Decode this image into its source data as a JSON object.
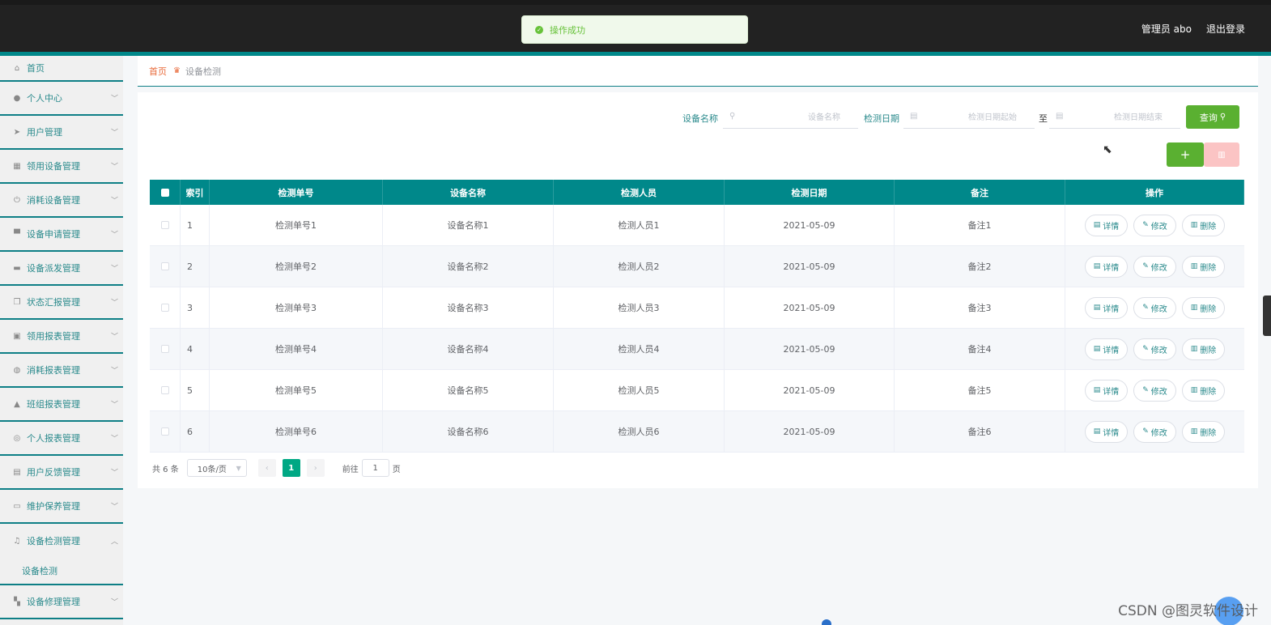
{
  "header": {
    "user": "管理员 abo",
    "logout": "退出登录"
  },
  "toast": {
    "message": "操作成功",
    "icon": "check-circle-icon"
  },
  "sidebar": {
    "items": [
      {
        "label": "首页",
        "icon": "home-icon"
      },
      {
        "label": "个人中心",
        "icon": "user-icon"
      },
      {
        "label": "用户管理",
        "icon": "send-icon"
      },
      {
        "label": "领用设备管理",
        "icon": "chart-icon"
      },
      {
        "label": "消耗设备管理",
        "icon": "power-icon"
      },
      {
        "label": "设备申请管理",
        "icon": "stamp-icon"
      },
      {
        "label": "设备派发管理",
        "icon": "printer-icon"
      },
      {
        "label": "状态汇报管理",
        "icon": "copy-icon"
      },
      {
        "label": "领用报表管理",
        "icon": "picture-icon"
      },
      {
        "label": "消耗报表管理",
        "icon": "basketball-icon"
      },
      {
        "label": "班组报表管理",
        "icon": "user-solid-icon"
      },
      {
        "label": "个人报表管理",
        "icon": "compass-icon"
      },
      {
        "label": "用户反馈管理",
        "icon": "clipboard-icon"
      },
      {
        "label": "维护保养管理",
        "icon": "chat-icon"
      },
      {
        "label": "设备检测管理",
        "icon": "bell-icon"
      }
    ],
    "sub_item": "设备检测",
    "last_item": {
      "label": "设备修理管理",
      "icon": "grid-icon"
    }
  },
  "breadcrumb": {
    "home": "首页",
    "current": "设备检测"
  },
  "search": {
    "name_label": "设备名称",
    "name_placeholder": "设备名称",
    "date_label": "检测日期",
    "date_start_placeholder": "检测日期起始",
    "date_sep": "至",
    "date_end_placeholder": "检测日期结束",
    "query_label": "查询"
  },
  "table": {
    "headers": [
      "索引",
      "检测单号",
      "设备名称",
      "检测人员",
      "检测日期",
      "备注",
      "操作"
    ],
    "rows": [
      {
        "idx": "1",
        "no": "检测单号1",
        "name": "设备名称1",
        "person": "检测人员1",
        "date": "2021-05-09",
        "note": "备注1"
      },
      {
        "idx": "2",
        "no": "检测单号2",
        "name": "设备名称2",
        "person": "检测人员2",
        "date": "2021-05-09",
        "note": "备注2"
      },
      {
        "idx": "3",
        "no": "检测单号3",
        "name": "设备名称3",
        "person": "检测人员3",
        "date": "2021-05-09",
        "note": "备注3"
      },
      {
        "idx": "4",
        "no": "检测单号4",
        "name": "设备名称4",
        "person": "检测人员4",
        "date": "2021-05-09",
        "note": "备注4"
      },
      {
        "idx": "5",
        "no": "检测单号5",
        "name": "设备名称5",
        "person": "检测人员5",
        "date": "2021-05-09",
        "note": "备注5"
      },
      {
        "idx": "6",
        "no": "检测单号6",
        "name": "设备名称6",
        "person": "检测人员6",
        "date": "2021-05-09",
        "note": "备注6"
      }
    ],
    "actions": {
      "detail": "详情",
      "edit": "修改",
      "delete": "删除"
    }
  },
  "pagination": {
    "total": "共 6 条",
    "page_size": "10条/页",
    "current": "1",
    "goto": "前往",
    "goto_value": "1",
    "page_unit": "页"
  },
  "watermark": "CSDN @图灵软件设计",
  "colors": {
    "accent": "#00888a",
    "success": "#5ab031",
    "danger_light": "#fbc4c4"
  }
}
